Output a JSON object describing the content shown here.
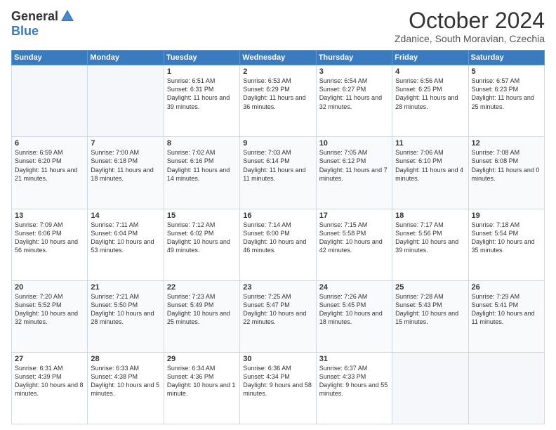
{
  "header": {
    "logo_general": "General",
    "logo_blue": "Blue",
    "month_title": "October 2024",
    "location": "Zdanice, South Moravian, Czechia"
  },
  "weekdays": [
    "Sunday",
    "Monday",
    "Tuesday",
    "Wednesday",
    "Thursday",
    "Friday",
    "Saturday"
  ],
  "weeks": [
    [
      {
        "day": "",
        "empty": true
      },
      {
        "day": "",
        "empty": true
      },
      {
        "day": "1",
        "sunrise": "6:51 AM",
        "sunset": "6:31 PM",
        "daylight": "11 hours and 39 minutes."
      },
      {
        "day": "2",
        "sunrise": "6:53 AM",
        "sunset": "6:29 PM",
        "daylight": "11 hours and 36 minutes."
      },
      {
        "day": "3",
        "sunrise": "6:54 AM",
        "sunset": "6:27 PM",
        "daylight": "11 hours and 32 minutes."
      },
      {
        "day": "4",
        "sunrise": "6:56 AM",
        "sunset": "6:25 PM",
        "daylight": "11 hours and 28 minutes."
      },
      {
        "day": "5",
        "sunrise": "6:57 AM",
        "sunset": "6:23 PM",
        "daylight": "11 hours and 25 minutes."
      }
    ],
    [
      {
        "day": "6",
        "sunrise": "6:59 AM",
        "sunset": "6:20 PM",
        "daylight": "11 hours and 21 minutes."
      },
      {
        "day": "7",
        "sunrise": "7:00 AM",
        "sunset": "6:18 PM",
        "daylight": "11 hours and 18 minutes."
      },
      {
        "day": "8",
        "sunrise": "7:02 AM",
        "sunset": "6:16 PM",
        "daylight": "11 hours and 14 minutes."
      },
      {
        "day": "9",
        "sunrise": "7:03 AM",
        "sunset": "6:14 PM",
        "daylight": "11 hours and 11 minutes."
      },
      {
        "day": "10",
        "sunrise": "7:05 AM",
        "sunset": "6:12 PM",
        "daylight": "11 hours and 7 minutes."
      },
      {
        "day": "11",
        "sunrise": "7:06 AM",
        "sunset": "6:10 PM",
        "daylight": "11 hours and 4 minutes."
      },
      {
        "day": "12",
        "sunrise": "7:08 AM",
        "sunset": "6:08 PM",
        "daylight": "11 hours and 0 minutes."
      }
    ],
    [
      {
        "day": "13",
        "sunrise": "7:09 AM",
        "sunset": "6:06 PM",
        "daylight": "10 hours and 56 minutes."
      },
      {
        "day": "14",
        "sunrise": "7:11 AM",
        "sunset": "6:04 PM",
        "daylight": "10 hours and 53 minutes."
      },
      {
        "day": "15",
        "sunrise": "7:12 AM",
        "sunset": "6:02 PM",
        "daylight": "10 hours and 49 minutes."
      },
      {
        "day": "16",
        "sunrise": "7:14 AM",
        "sunset": "6:00 PM",
        "daylight": "10 hours and 46 minutes."
      },
      {
        "day": "17",
        "sunrise": "7:15 AM",
        "sunset": "5:58 PM",
        "daylight": "10 hours and 42 minutes."
      },
      {
        "day": "18",
        "sunrise": "7:17 AM",
        "sunset": "5:56 PM",
        "daylight": "10 hours and 39 minutes."
      },
      {
        "day": "19",
        "sunrise": "7:18 AM",
        "sunset": "5:54 PM",
        "daylight": "10 hours and 35 minutes."
      }
    ],
    [
      {
        "day": "20",
        "sunrise": "7:20 AM",
        "sunset": "5:52 PM",
        "daylight": "10 hours and 32 minutes."
      },
      {
        "day": "21",
        "sunrise": "7:21 AM",
        "sunset": "5:50 PM",
        "daylight": "10 hours and 28 minutes."
      },
      {
        "day": "22",
        "sunrise": "7:23 AM",
        "sunset": "5:49 PM",
        "daylight": "10 hours and 25 minutes."
      },
      {
        "day": "23",
        "sunrise": "7:25 AM",
        "sunset": "5:47 PM",
        "daylight": "10 hours and 22 minutes."
      },
      {
        "day": "24",
        "sunrise": "7:26 AM",
        "sunset": "5:45 PM",
        "daylight": "10 hours and 18 minutes."
      },
      {
        "day": "25",
        "sunrise": "7:28 AM",
        "sunset": "5:43 PM",
        "daylight": "10 hours and 15 minutes."
      },
      {
        "day": "26",
        "sunrise": "7:29 AM",
        "sunset": "5:41 PM",
        "daylight": "10 hours and 11 minutes."
      }
    ],
    [
      {
        "day": "27",
        "sunrise": "6:31 AM",
        "sunset": "4:39 PM",
        "daylight": "10 hours and 8 minutes."
      },
      {
        "day": "28",
        "sunrise": "6:33 AM",
        "sunset": "4:38 PM",
        "daylight": "10 hours and 5 minutes."
      },
      {
        "day": "29",
        "sunrise": "6:34 AM",
        "sunset": "4:36 PM",
        "daylight": "10 hours and 1 minute."
      },
      {
        "day": "30",
        "sunrise": "6:36 AM",
        "sunset": "4:34 PM",
        "daylight": "9 hours and 58 minutes."
      },
      {
        "day": "31",
        "sunrise": "6:37 AM",
        "sunset": "4:33 PM",
        "daylight": "9 hours and 55 minutes."
      },
      {
        "day": "",
        "empty": true
      },
      {
        "day": "",
        "empty": true
      }
    ]
  ]
}
